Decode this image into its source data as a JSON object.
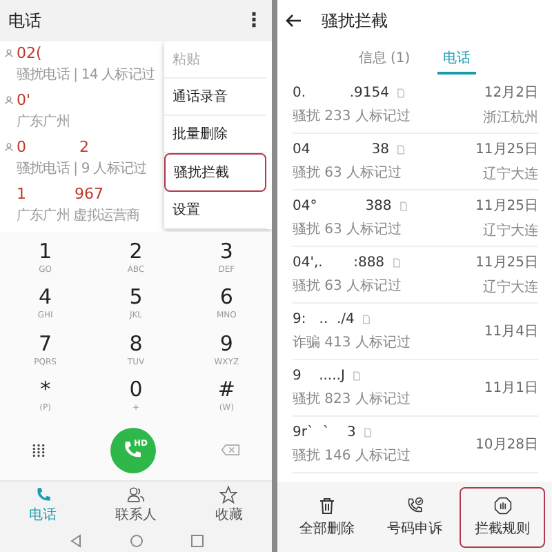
{
  "left": {
    "title": "电话",
    "menu_icon": "⋮",
    "calls": [
      {
        "number": "02(",
        "detail": "骚扰电话 | 14 人标记过",
        "contact_icon": true
      },
      {
        "number": "0'",
        "detail": "广东广州",
        "contact_icon": true
      },
      {
        "number": "0           2",
        "detail": "骚扰电话 | 9 人标记过",
        "contact_icon": true
      },
      {
        "number": "1          967",
        "detail": "广东广州 虚拟运营商",
        "contact_icon": false
      }
    ],
    "menu": [
      {
        "label": "粘贴",
        "disabled": true,
        "highlighted": false
      },
      {
        "label": "通话录音",
        "disabled": false,
        "highlighted": false
      },
      {
        "label": "批量删除",
        "disabled": false,
        "highlighted": false
      },
      {
        "label": "骚扰拦截",
        "disabled": false,
        "highlighted": true
      },
      {
        "label": "设置",
        "disabled": false,
        "highlighted": false
      }
    ],
    "keys": [
      {
        "digit": "1",
        "letters": "GO"
      },
      {
        "digit": "2",
        "letters": "ABC"
      },
      {
        "digit": "3",
        "letters": "DEF"
      },
      {
        "digit": "4",
        "letters": "GHI"
      },
      {
        "digit": "5",
        "letters": "JKL"
      },
      {
        "digit": "6",
        "letters": "MNO"
      },
      {
        "digit": "7",
        "letters": "PQRS"
      },
      {
        "digit": "8",
        "letters": "TUV"
      },
      {
        "digit": "9",
        "letters": "WXYZ"
      },
      {
        "digit": "*",
        "letters": "(P)"
      },
      {
        "digit": "0",
        "letters": "+"
      },
      {
        "digit": "#",
        "letters": "(W)"
      }
    ],
    "call_badge": "HD",
    "nav": [
      {
        "label": "电话",
        "selected": true
      },
      {
        "label": "联系人",
        "selected": false
      },
      {
        "label": "收藏",
        "selected": false
      }
    ]
  },
  "right": {
    "title": "骚扰拦截",
    "tabs": [
      {
        "label": "信息 (1)",
        "selected": false
      },
      {
        "label": "电话",
        "selected": true
      }
    ],
    "records": [
      {
        "number": "0.          .9154",
        "date": "12月2日",
        "tag": "骚扰",
        "count": "233 人标记过",
        "location": "浙江杭州"
      },
      {
        "number": "04              38",
        "date": "11月25日",
        "tag": "骚扰",
        "count": "63 人标记过",
        "location": "辽宁大连"
      },
      {
        "number": "04°           388",
        "date": "11月25日",
        "tag": "骚扰",
        "count": "63 人标记过",
        "location": "辽宁大连"
      },
      {
        "number": "04',.       :888",
        "date": "11月25日",
        "tag": "骚扰",
        "count": "63 人标记过",
        "location": "辽宁大连"
      },
      {
        "number": "9:   ..  ./4",
        "date": "11月4日",
        "tag": "诈骗",
        "count": "413 人标记过"
      },
      {
        "number": "9    .....J",
        "date": "11月1日",
        "tag": "骚扰",
        "count": "823 人标记过"
      },
      {
        "number": "9r`  `    3",
        "date": "10月28日",
        "tag": "骚扰",
        "count": "146 人标记过"
      }
    ],
    "actions": [
      {
        "label": "全部删除",
        "highlighted": false
      },
      {
        "label": "号码申诉",
        "highlighted": false
      },
      {
        "label": "拦截规则",
        "highlighted": true
      }
    ]
  }
}
